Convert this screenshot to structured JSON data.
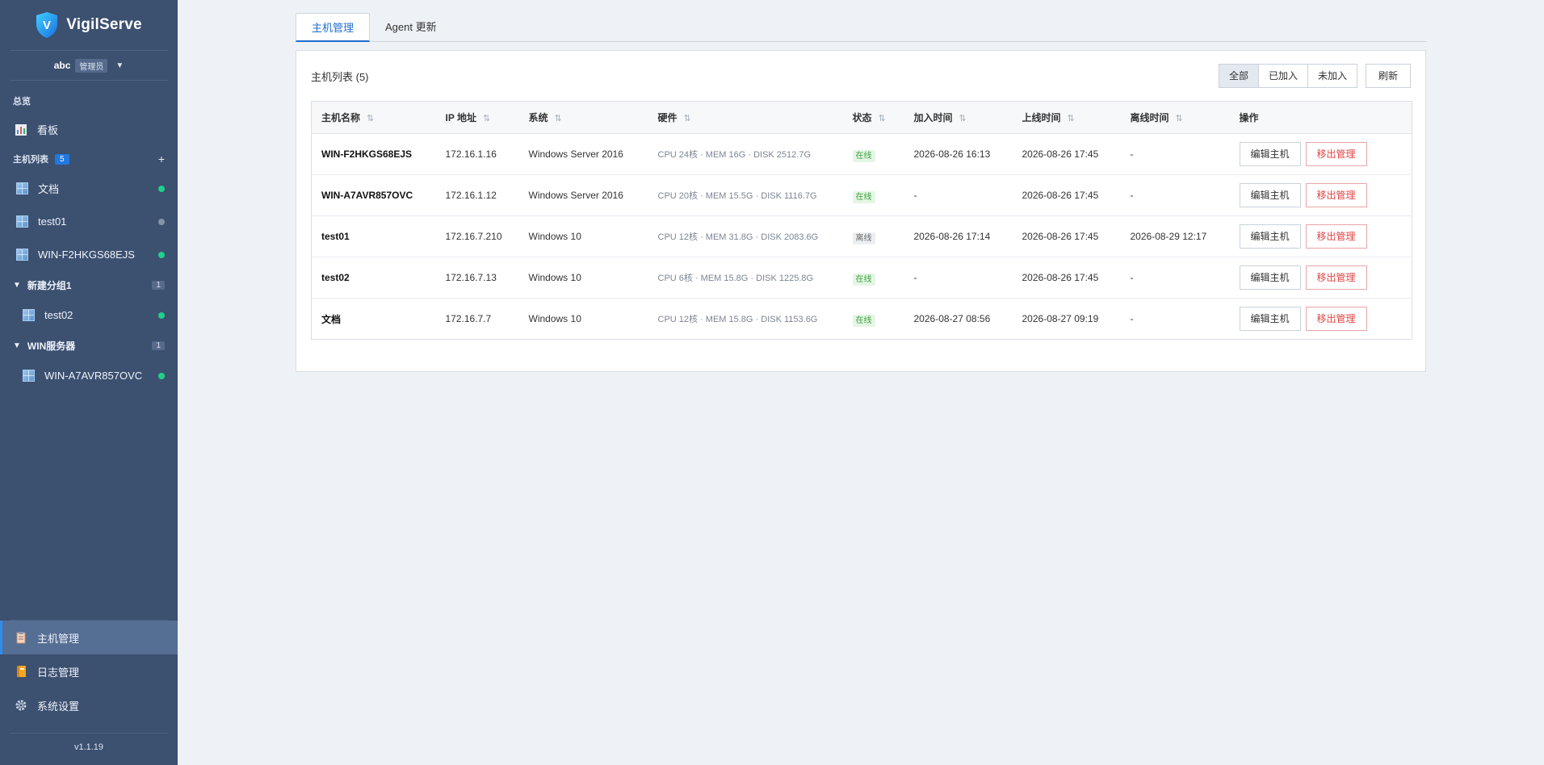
{
  "brand": {
    "name": "VigilServe",
    "logo_letter": "V"
  },
  "user": {
    "name": "abc",
    "role": "管理员"
  },
  "sidebar": {
    "overview_label": "总览",
    "dashboard_label": "看板",
    "hostlist_label": "主机列表",
    "hostlist_count": "5",
    "hosts": [
      {
        "name": "文档",
        "status": "online"
      },
      {
        "name": "test01",
        "status": "offline"
      },
      {
        "name": "WIN-F2HKGS68EJS",
        "status": "online"
      }
    ],
    "groups": [
      {
        "name": "新建分组1",
        "count": "1",
        "hosts": [
          {
            "name": "test02",
            "status": "online"
          }
        ]
      },
      {
        "name": "WIN服务器",
        "count": "1",
        "hosts": [
          {
            "name": "WIN-A7AVR857OVC",
            "status": "online"
          }
        ]
      }
    ],
    "bottom_nav": [
      {
        "label": "主机管理",
        "active": true
      },
      {
        "label": "日志管理",
        "active": false
      },
      {
        "label": "系统设置",
        "active": false
      }
    ],
    "version": "v1.1.19"
  },
  "tabs": [
    {
      "label": "主机管理",
      "active": true
    },
    {
      "label": "Agent 更新",
      "active": false
    }
  ],
  "card": {
    "title": "主机列表 (5)",
    "filters": [
      {
        "label": "全部",
        "active": true
      },
      {
        "label": "已加入",
        "active": false
      },
      {
        "label": "未加入",
        "active": false
      }
    ],
    "refresh_label": "刷新"
  },
  "table": {
    "columns": [
      "主机名称",
      "IP 地址",
      "系统",
      "硬件",
      "状态",
      "加入时间",
      "上线时间",
      "离线时间",
      "操作"
    ],
    "sortable": [
      true,
      true,
      true,
      true,
      true,
      true,
      true,
      true,
      false
    ],
    "rows": [
      {
        "name": "WIN-F2HKGS68EJS",
        "ip": "172.16.1.16",
        "os": "Windows Server 2016",
        "hw": "CPU 24核 · MEM 16G · DISK 2512.7G",
        "status": "在线",
        "online": true,
        "joined": "2026-08-26 16:13",
        "up": "2026-08-26 17:45",
        "down": "-"
      },
      {
        "name": "WIN-A7AVR857OVC",
        "ip": "172.16.1.12",
        "os": "Windows Server 2016",
        "hw": "CPU 20核 · MEM 15.5G · DISK 1116.7G",
        "status": "在线",
        "online": true,
        "joined": "-",
        "up": "2026-08-26 17:45",
        "down": "-"
      },
      {
        "name": "test01",
        "ip": "172.16.7.210",
        "os": "Windows 10",
        "hw": "CPU 12核 · MEM 31.8G · DISK 2083.6G",
        "status": "离线",
        "online": false,
        "joined": "2026-08-26 17:14",
        "up": "2026-08-26 17:45",
        "down": "2026-08-29 12:17"
      },
      {
        "name": "test02",
        "ip": "172.16.7.13",
        "os": "Windows 10",
        "hw": "CPU 6核 · MEM 15.8G · DISK 1225.8G",
        "status": "在线",
        "online": true,
        "joined": "-",
        "up": "2026-08-26 17:45",
        "down": "-"
      },
      {
        "name": "文档",
        "ip": "172.16.7.7",
        "os": "Windows 10",
        "hw": "CPU 12核 · MEM 15.8G · DISK 1153.6G",
        "status": "在线",
        "online": true,
        "joined": "2026-08-27 08:56",
        "up": "2026-08-27 09:19",
        "down": "-"
      }
    ],
    "edit_label": "编辑主机",
    "remove_label": "移出管理",
    "sort_glyph": "⇅"
  },
  "colors": {
    "sidebar": "#3c5070",
    "accent": "#1f6fd0",
    "online": "#1fd08a",
    "danger": "#e04545"
  }
}
